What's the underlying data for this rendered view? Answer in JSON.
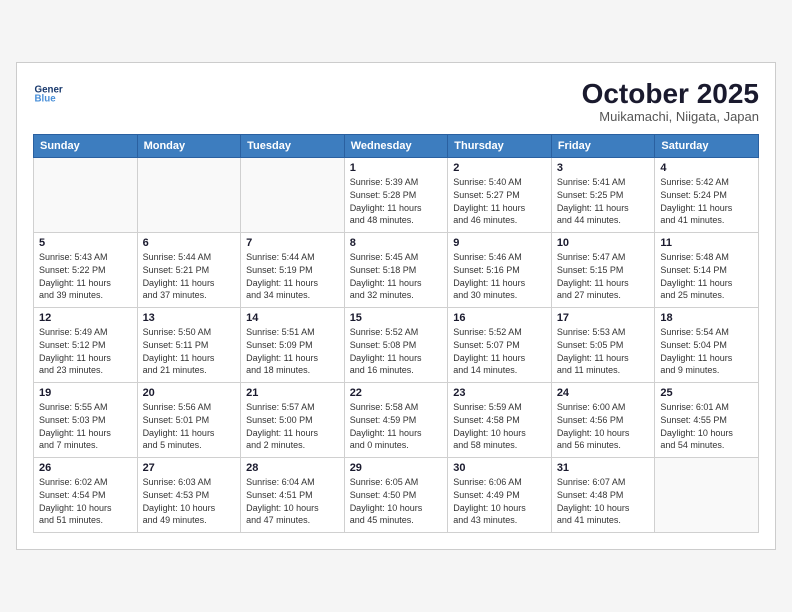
{
  "header": {
    "logo_line1": "General",
    "logo_line2": "Blue",
    "month": "October 2025",
    "location": "Muikamachi, Niigata, Japan"
  },
  "weekdays": [
    "Sunday",
    "Monday",
    "Tuesday",
    "Wednesday",
    "Thursday",
    "Friday",
    "Saturday"
  ],
  "weeks": [
    [
      {
        "day": "",
        "info": ""
      },
      {
        "day": "",
        "info": ""
      },
      {
        "day": "",
        "info": ""
      },
      {
        "day": "1",
        "info": "Sunrise: 5:39 AM\nSunset: 5:28 PM\nDaylight: 11 hours\nand 48 minutes."
      },
      {
        "day": "2",
        "info": "Sunrise: 5:40 AM\nSunset: 5:27 PM\nDaylight: 11 hours\nand 46 minutes."
      },
      {
        "day": "3",
        "info": "Sunrise: 5:41 AM\nSunset: 5:25 PM\nDaylight: 11 hours\nand 44 minutes."
      },
      {
        "day": "4",
        "info": "Sunrise: 5:42 AM\nSunset: 5:24 PM\nDaylight: 11 hours\nand 41 minutes."
      }
    ],
    [
      {
        "day": "5",
        "info": "Sunrise: 5:43 AM\nSunset: 5:22 PM\nDaylight: 11 hours\nand 39 minutes."
      },
      {
        "day": "6",
        "info": "Sunrise: 5:44 AM\nSunset: 5:21 PM\nDaylight: 11 hours\nand 37 minutes."
      },
      {
        "day": "7",
        "info": "Sunrise: 5:44 AM\nSunset: 5:19 PM\nDaylight: 11 hours\nand 34 minutes."
      },
      {
        "day": "8",
        "info": "Sunrise: 5:45 AM\nSunset: 5:18 PM\nDaylight: 11 hours\nand 32 minutes."
      },
      {
        "day": "9",
        "info": "Sunrise: 5:46 AM\nSunset: 5:16 PM\nDaylight: 11 hours\nand 30 minutes."
      },
      {
        "day": "10",
        "info": "Sunrise: 5:47 AM\nSunset: 5:15 PM\nDaylight: 11 hours\nand 27 minutes."
      },
      {
        "day": "11",
        "info": "Sunrise: 5:48 AM\nSunset: 5:14 PM\nDaylight: 11 hours\nand 25 minutes."
      }
    ],
    [
      {
        "day": "12",
        "info": "Sunrise: 5:49 AM\nSunset: 5:12 PM\nDaylight: 11 hours\nand 23 minutes."
      },
      {
        "day": "13",
        "info": "Sunrise: 5:50 AM\nSunset: 5:11 PM\nDaylight: 11 hours\nand 21 minutes."
      },
      {
        "day": "14",
        "info": "Sunrise: 5:51 AM\nSunset: 5:09 PM\nDaylight: 11 hours\nand 18 minutes."
      },
      {
        "day": "15",
        "info": "Sunrise: 5:52 AM\nSunset: 5:08 PM\nDaylight: 11 hours\nand 16 minutes."
      },
      {
        "day": "16",
        "info": "Sunrise: 5:52 AM\nSunset: 5:07 PM\nDaylight: 11 hours\nand 14 minutes."
      },
      {
        "day": "17",
        "info": "Sunrise: 5:53 AM\nSunset: 5:05 PM\nDaylight: 11 hours\nand 11 minutes."
      },
      {
        "day": "18",
        "info": "Sunrise: 5:54 AM\nSunset: 5:04 PM\nDaylight: 11 hours\nand 9 minutes."
      }
    ],
    [
      {
        "day": "19",
        "info": "Sunrise: 5:55 AM\nSunset: 5:03 PM\nDaylight: 11 hours\nand 7 minutes."
      },
      {
        "day": "20",
        "info": "Sunrise: 5:56 AM\nSunset: 5:01 PM\nDaylight: 11 hours\nand 5 minutes."
      },
      {
        "day": "21",
        "info": "Sunrise: 5:57 AM\nSunset: 5:00 PM\nDaylight: 11 hours\nand 2 minutes."
      },
      {
        "day": "22",
        "info": "Sunrise: 5:58 AM\nSunset: 4:59 PM\nDaylight: 11 hours\nand 0 minutes."
      },
      {
        "day": "23",
        "info": "Sunrise: 5:59 AM\nSunset: 4:58 PM\nDaylight: 10 hours\nand 58 minutes."
      },
      {
        "day": "24",
        "info": "Sunrise: 6:00 AM\nSunset: 4:56 PM\nDaylight: 10 hours\nand 56 minutes."
      },
      {
        "day": "25",
        "info": "Sunrise: 6:01 AM\nSunset: 4:55 PM\nDaylight: 10 hours\nand 54 minutes."
      }
    ],
    [
      {
        "day": "26",
        "info": "Sunrise: 6:02 AM\nSunset: 4:54 PM\nDaylight: 10 hours\nand 51 minutes."
      },
      {
        "day": "27",
        "info": "Sunrise: 6:03 AM\nSunset: 4:53 PM\nDaylight: 10 hours\nand 49 minutes."
      },
      {
        "day": "28",
        "info": "Sunrise: 6:04 AM\nSunset: 4:51 PM\nDaylight: 10 hours\nand 47 minutes."
      },
      {
        "day": "29",
        "info": "Sunrise: 6:05 AM\nSunset: 4:50 PM\nDaylight: 10 hours\nand 45 minutes."
      },
      {
        "day": "30",
        "info": "Sunrise: 6:06 AM\nSunset: 4:49 PM\nDaylight: 10 hours\nand 43 minutes."
      },
      {
        "day": "31",
        "info": "Sunrise: 6:07 AM\nSunset: 4:48 PM\nDaylight: 10 hours\nand 41 minutes."
      },
      {
        "day": "",
        "info": ""
      }
    ]
  ]
}
